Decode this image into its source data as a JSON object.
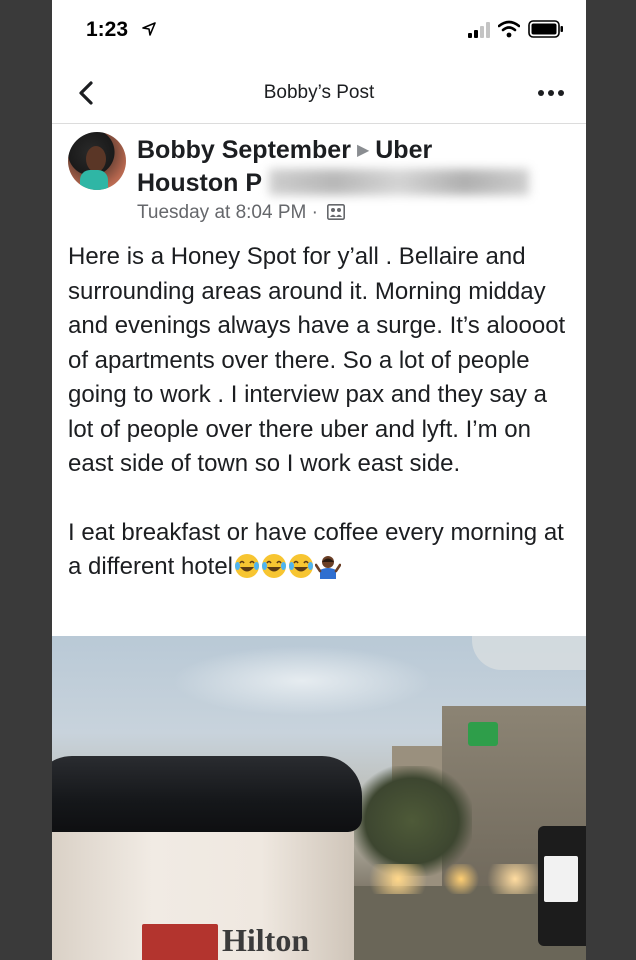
{
  "status_bar": {
    "time": "1:23"
  },
  "nav": {
    "title": "Bobby’s Post"
  },
  "post": {
    "author": "Bobby September",
    "group_name": "Uber",
    "group_name_line2": "Houston P",
    "timestamp": "Tuesday at 8:04 PM",
    "separator": "·",
    "paragraphs": [
      "Here is a Honey Spot for y’all . Bellaire and surrounding areas around it. Morning midday and evenings always have a surge. It’s aloooot of apartments over there. So a lot of people going to work . I interview pax and they say a lot of people over there uber and lyft. I’m on east side of town so I work east side.",
      "I eat breakfast or have coffee every morning at a different hotel"
    ],
    "emojis": [
      "face-with-tears-of-joy",
      "face-with-tears-of-joy",
      "face-with-tears-of-joy",
      "person-shrugging"
    ],
    "photo": {
      "cup_text": "Hilton"
    }
  },
  "colors": {
    "text": "#1c1e21",
    "meta": "#65676b",
    "hilton_red": "#b3342e"
  }
}
